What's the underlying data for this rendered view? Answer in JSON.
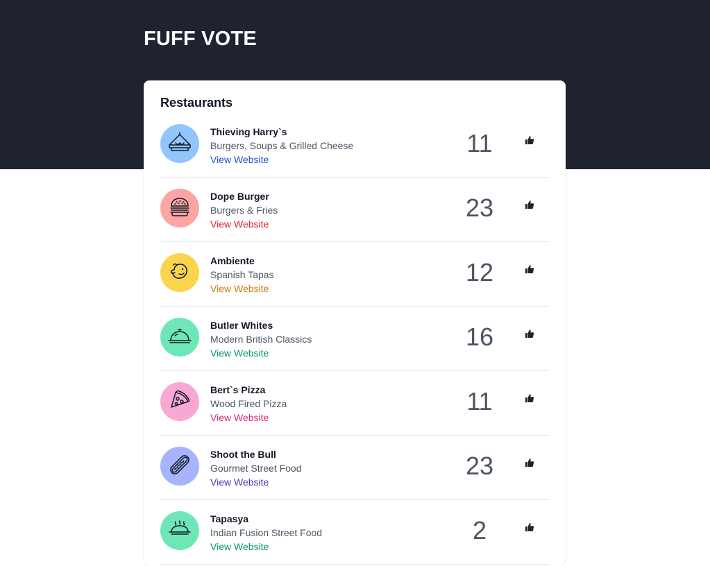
{
  "app": {
    "title": "FUFF VOTE"
  },
  "card": {
    "title": "Restaurants"
  },
  "colors": {
    "header_bg": "#1f2330",
    "blue": "#1d4ed8",
    "red": "#dc2626",
    "amber": "#d97706",
    "green": "#059669",
    "pink": "#db2777",
    "indigo": "#4338ca"
  },
  "restaurants": [
    {
      "name": "Thieving Harry`s",
      "cuisine": "Burgers, Soups & Grilled Cheese",
      "link": "View Website",
      "votes": "11",
      "icon": "sandwich-icon",
      "bg": "#93c5fd",
      "link_color": "#1d4ed8"
    },
    {
      "name": "Dope Burger",
      "cuisine": "Burgers & Fries",
      "link": "View Website",
      "votes": "23",
      "icon": "burger-icon",
      "bg": "#fca5a5",
      "link_color": "#dc2626"
    },
    {
      "name": "Ambiente",
      "cuisine": "Spanish Tapas",
      "link": "View Website",
      "votes": "12",
      "icon": "chicken-icon",
      "bg": "#fcd34d",
      "link_color": "#d97706"
    },
    {
      "name": "Butler Whites",
      "cuisine": "Modern British Classics",
      "link": "View Website",
      "votes": "16",
      "icon": "cloche-icon",
      "bg": "#6ee7b7",
      "link_color": "#059669"
    },
    {
      "name": "Bert`s Pizza",
      "cuisine": "Wood Fired Pizza",
      "link": "View Website",
      "votes": "11",
      "icon": "pizza-icon",
      "bg": "#f9a8d4",
      "link_color": "#db2777"
    },
    {
      "name": "Shoot the Bull",
      "cuisine": "Gourmet Street Food",
      "link": "View Website",
      "votes": "23",
      "icon": "hotdog-icon",
      "bg": "#a5b4fc",
      "link_color": "#4338ca"
    },
    {
      "name": "Tapasya",
      "cuisine": "Indian Fusion Street Food",
      "link": "View Website",
      "votes": "2",
      "icon": "hot-dish-icon",
      "bg": "#6ee7b7",
      "link_color": "#059669"
    }
  ]
}
